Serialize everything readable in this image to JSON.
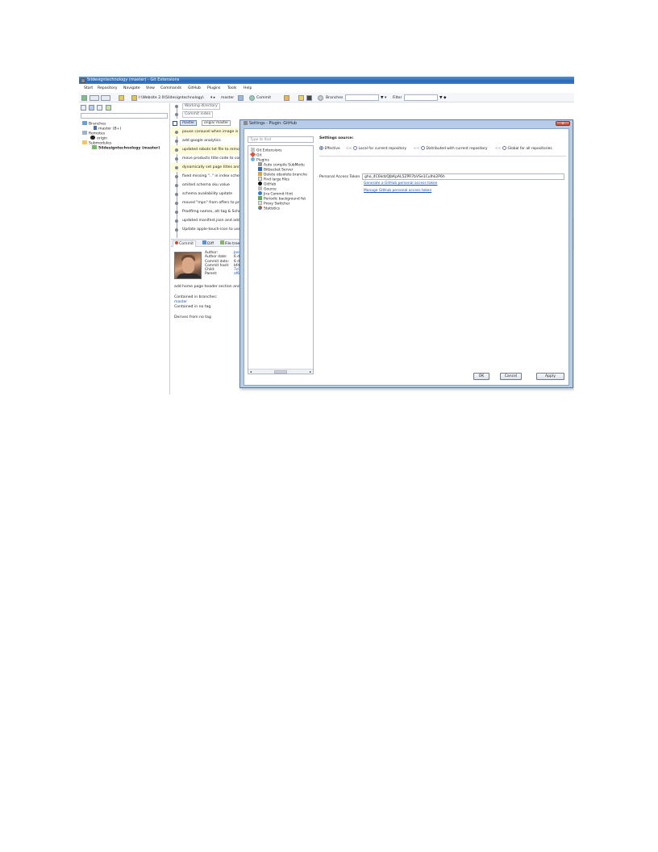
{
  "window": {
    "title": "5ildesigntechnology (master) - Git Extensions"
  },
  "menu": [
    "Start",
    "Repository",
    "Navigate",
    "View",
    "Commands",
    "GitHub",
    "Plugins",
    "Tools",
    "Help"
  ],
  "toolbar": {
    "path": "I:\\Website 2.0\\5ildesigntechnology\\",
    "branch": "master",
    "commit_label": "Commit",
    "branches_label": "Branches",
    "filter_label": "Filter"
  },
  "left_tree": {
    "branches": "Branches",
    "branch_master": "master (B+)",
    "remotes": "Remotes",
    "remote_origin": "origin",
    "submodules": "Submodules",
    "submodule_item": "5ildesigntechnology (master)"
  },
  "revisions": {
    "working_directory": "Working directory",
    "commit_index": "Commit index",
    "tag_master": "master",
    "tag_origin": "origin/ master",
    "messages": [
      "pause carousel when image is se",
      "add google analytics",
      "updated robots txt file to remove",
      "move products title code to comi",
      "dynamically set page titles and m",
      "fixed missing \"..\" in index schemi",
      "omited schema sku value",
      "schema availability update",
      "moved \"mpn\" from offers to pro",
      "Prodfimg names, alt tag & Schem",
      "updated manifest.json and add fo",
      "Update apple-touch-icon to use i"
    ]
  },
  "detail_tabs": {
    "commit": "Commit",
    "diff": "Diff",
    "file_tree": "File tree"
  },
  "commit_info": {
    "author_k": "Author:",
    "author_v": "Joe",
    "author_date_k": "Author date:",
    "author_date_v": "6 da",
    "commit_date_k": "Commit date:",
    "commit_date_v": "6 da",
    "commit_hash_k": "Commit hash:",
    "commit_hash_v": "bfdc",
    "child_k": "Child:",
    "child_v": "7c0",
    "parent_k": "Parent:",
    "parent_v": "af6",
    "message": "add home page header section and s",
    "contained_in_branches": "Contained in branches:",
    "branch_link": "master",
    "contained_in_no_tag": "Contained in no tag",
    "derives_from": "Derives from no tag"
  },
  "dialog": {
    "title": "Settings - Plugin: GitHub",
    "close": "x",
    "search_placeholder": "Type to find",
    "tree": [
      "Git Extensions",
      "Git",
      "Plugins",
      "Auto compile SubModu",
      "Bitbucket Server",
      "Delete obsolete branche",
      "Find large files",
      "GitHub",
      "Gource",
      "Jira Commit Hint",
      "Periodic background fet",
      "Proxy Switcher",
      "Statistics"
    ],
    "settings_source_label": "Settings source:",
    "radio_effective": "Effective",
    "radio_local": "Local for current repository",
    "radio_distributed": "Distributed with current repository",
    "radio_global": "Global for all repositories",
    "arrow_sep": "<<",
    "pat_label": "Personal Access Token",
    "pat_value": "gho_4C6kdzQJbKpAL5ZPR7bVSe1CuIhk2P6h",
    "link_generate": "Generate a GitHub personal access token",
    "link_manage": "Manage GitHub personal access token",
    "ok": "OK",
    "cancel": "Cancel",
    "apply": "Apply"
  },
  "colors": {
    "titlebar": "#2d68b4",
    "row_highlight": "#fdfbd8",
    "link": "#1c52b5",
    "dialog_frame": "#b7cce6"
  }
}
